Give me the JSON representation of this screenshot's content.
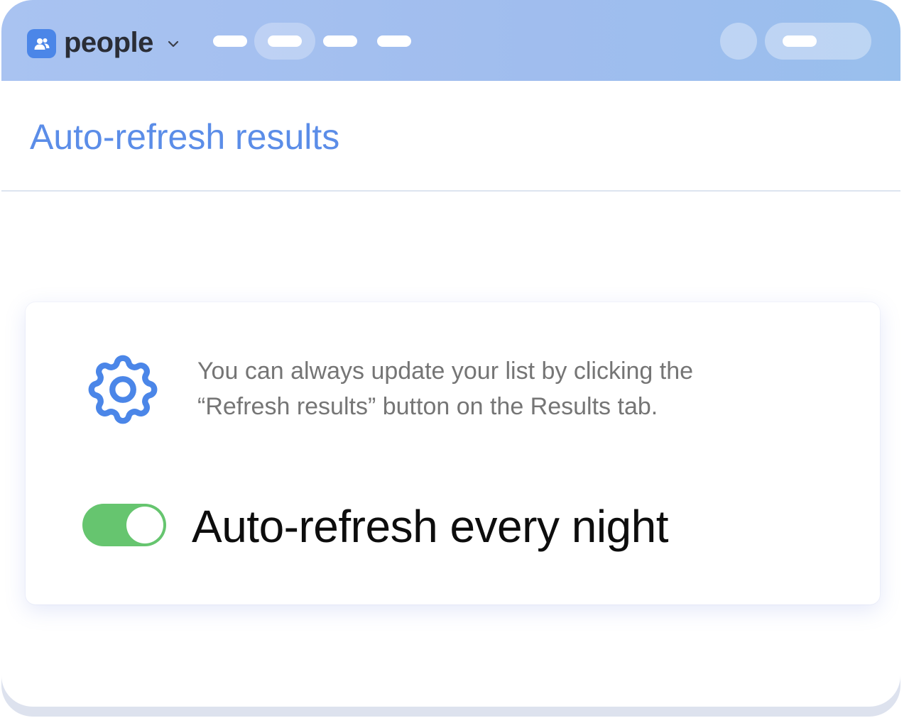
{
  "app": {
    "name": "people",
    "logo_icon": "people-icon",
    "switcher_icon": "chevron-down-icon"
  },
  "header": {
    "title": "Auto-refresh results"
  },
  "card": {
    "info_icon": "gear-icon",
    "info_text": "You can always update your list by clicking the “Refresh results” button on the Results tab.",
    "toggle": {
      "label": "Auto-refresh every night",
      "state": "on"
    }
  },
  "colors": {
    "accent": "#5b8de8",
    "icon_blue": "#4b86e8",
    "toggle_on": "#66c56f",
    "topbar": "#a3c0ef"
  }
}
